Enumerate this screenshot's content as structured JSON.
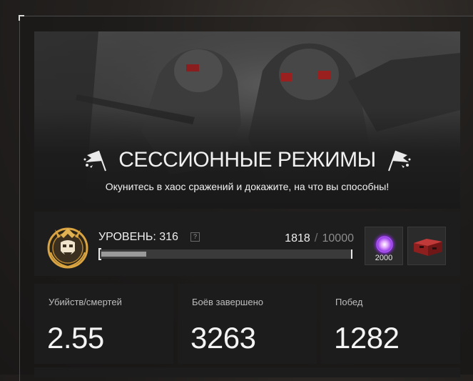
{
  "banner": {
    "title": "СЕССИОННЫЕ РЕЖИМЫ",
    "subtitle": "Окунитесь в хаос сражений и докажите, на что вы способны!",
    "left_icon": "flag-icon",
    "right_icon": "flag-icon"
  },
  "level": {
    "label": "УРОВЕНЬ: 316",
    "help_icon": "?",
    "xp_current": "1818",
    "xp_separator": "/",
    "xp_max": "10000",
    "progress_fraction": 0.1818,
    "badge_icon": "rank-badge-icon"
  },
  "rewards": [
    {
      "icon": "purple-crystal-icon",
      "count": "2000"
    },
    {
      "icon": "red-crate-icon"
    }
  ],
  "stats": [
    {
      "label": "Убийств/смертей",
      "value": "2.55"
    },
    {
      "label": "Боёв завершено",
      "value": "3263"
    },
    {
      "label": "Побед",
      "value": "1282"
    }
  ],
  "colors": {
    "panel": "#1c1c1c",
    "accent_gold": "#d9a441",
    "crystal_purple": "#b052f0",
    "crate_red": "#b32a2a"
  }
}
